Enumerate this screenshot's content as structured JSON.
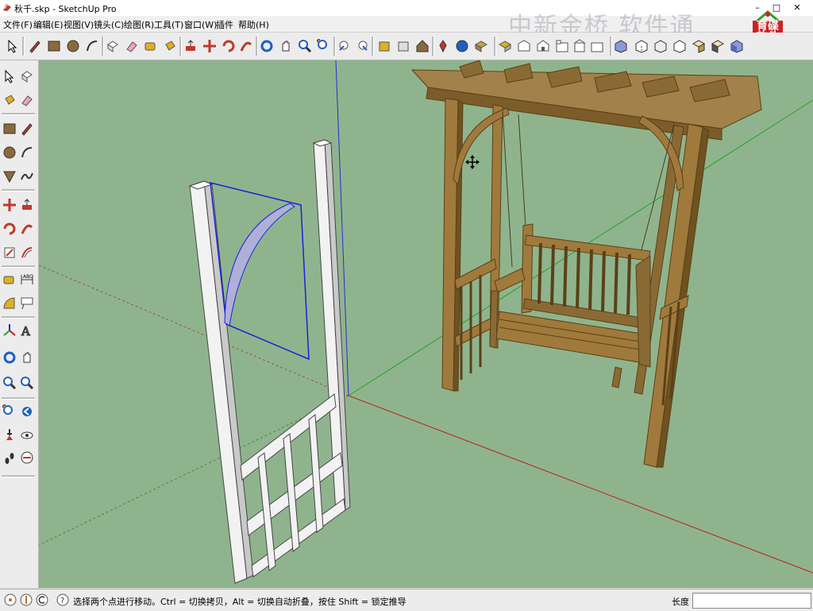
{
  "window": {
    "title": "秋千.skp - SketchUp Pro",
    "controls": {
      "minimize": "–",
      "maximize": "□",
      "close": "✕"
    }
  },
  "menu": {
    "items": [
      {
        "label": "文件(F)"
      },
      {
        "label": "编辑(E)"
      },
      {
        "label": "视图(V)"
      },
      {
        "label": "镜头(C)"
      },
      {
        "label": "绘图(R)"
      },
      {
        "label": "工具(T)"
      },
      {
        "label": "窗口(W)"
      },
      {
        "label": "插件"
      },
      {
        "label": "帮助(H)"
      }
    ]
  },
  "overlay": {
    "watermark": "中新金桥 软件通",
    "logo_text": "育碟软件"
  },
  "toolbar": {
    "tools": [
      "select-icon",
      "pencil-icon",
      "rectangle-icon",
      "circle-icon",
      "arc-icon",
      "make-component-icon",
      "eraser-icon",
      "tape-measure-icon",
      "paint-bucket-icon",
      "push-pull-icon",
      "move-icon",
      "rotate-icon",
      "follow-me-icon",
      "orbit-icon",
      "pan-icon",
      "zoom-icon",
      "zoom-extents-icon",
      "previous-view-icon",
      "next-view-icon",
      "get-models-icon",
      "share-model-icon",
      "3d-warehouse-icon",
      "add-location-icon",
      "toggle-terrain-icon",
      "photo-textures-icon",
      "iso-view-icon",
      "top-view-icon",
      "front-view-icon",
      "right-view-icon",
      "back-view-icon",
      "left-view-icon",
      "xray-icon",
      "back-edges-icon",
      "wireframe-icon",
      "hidden-line-icon",
      "shaded-icon",
      "shaded-textures-icon",
      "monochrome-icon"
    ]
  },
  "left_toolbar": {
    "tools": [
      "select-icon",
      "make-component-icon",
      "paint-bucket-icon",
      "eraser-icon",
      "rectangle-icon",
      "line-icon",
      "circle-icon",
      "arc-icon",
      "polygon-icon",
      "freehand-icon",
      "move-icon",
      "push-pull-icon",
      "rotate-icon",
      "follow-me-icon",
      "scale-icon",
      "offset-icon",
      "tape-measure-icon",
      "dimension-icon",
      "protractor-icon",
      "text-icon",
      "axes-icon",
      "3d-text-icon",
      "orbit-icon",
      "pan-icon",
      "zoom-icon",
      "zoom-window-icon",
      "zoom-extents-icon",
      "previous-icon",
      "position-camera-icon",
      "look-around-icon",
      "walk-icon",
      "section-plane-icon"
    ]
  },
  "status": {
    "message": "选择两个点进行移动。Ctrl = 切换拷贝，Alt = 切换自动折叠，按住 Shift = 锁定推导",
    "length_label": "长度",
    "length_value": ""
  },
  "colors": {
    "viewport_bg": "#8fb48d",
    "wood": "#a07a3c",
    "wood_dark": "#6e521f",
    "selection_blue": "#1a22d8",
    "axis_red": "#c02020",
    "axis_green": "#2aa02a",
    "axis_blue": "#2a2ad8"
  }
}
